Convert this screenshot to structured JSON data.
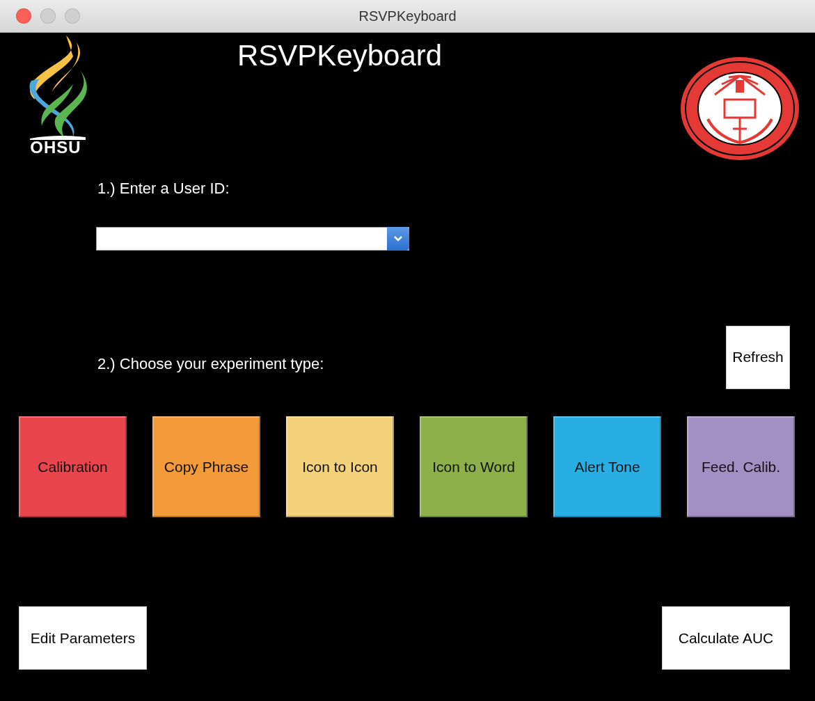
{
  "window": {
    "title": "RSVPKeyboard"
  },
  "header": {
    "title": "RSVPKeyboard",
    "logo_text": "OHSU"
  },
  "user_id": {
    "label": "1.) Enter a User ID:"
  },
  "experiment": {
    "label": "2.) Choose your experiment type:",
    "refresh": "Refresh",
    "types": [
      {
        "label": "Calibration",
        "color": "#e8464c"
      },
      {
        "label": "Copy Phrase",
        "color": "#f39a3a"
      },
      {
        "label": "Icon to Icon",
        "color": "#f4d27c"
      },
      {
        "label": "Icon to Word",
        "color": "#8db04a"
      },
      {
        "label": "Alert Tone",
        "color": "#29aee3"
      },
      {
        "label": "Feed. Calib.",
        "color": "#a48fc4"
      }
    ]
  },
  "actions": [
    {
      "label": "Edit Parameters"
    },
    {
      "label": "Calculate AUC"
    }
  ]
}
